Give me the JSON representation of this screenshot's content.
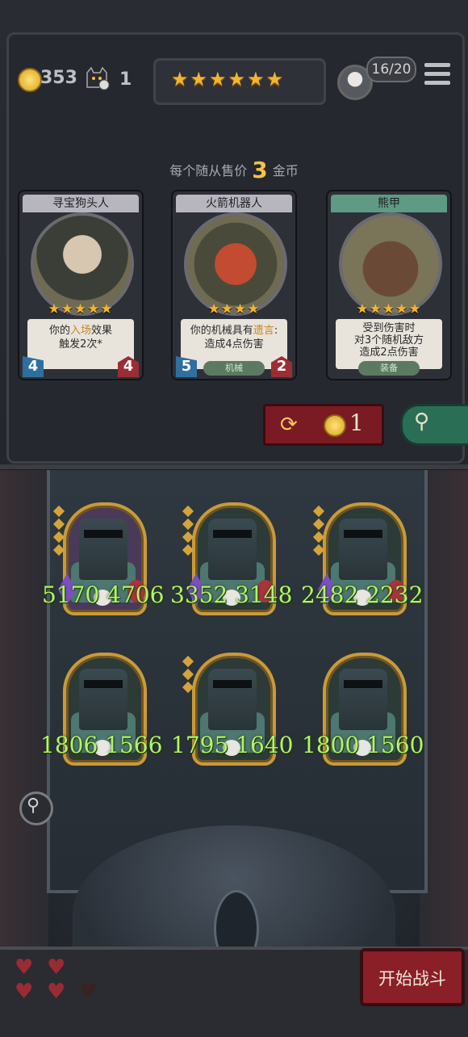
{
  "header": {
    "coins": "353",
    "turn": "1",
    "stars": "★★★★★★",
    "population": "16/20"
  },
  "shop": {
    "price_prefix": "每个随从售价",
    "price_value": "3",
    "price_suffix": "金币",
    "reroll_cost": "1",
    "cards": [
      {
        "name": "寻宝狗头人",
        "rank": "★★★★★",
        "desc_pre": "你的",
        "desc_hl": "入场",
        "desc_post": "效果",
        "desc_line2": "触发2次*",
        "attack": "4",
        "health": "4",
        "tribe": ""
      },
      {
        "name": "火箭机器人",
        "rank": "★★★★",
        "desc_pre": "你的机械具有",
        "desc_hl": "遗言",
        "desc_post": ":",
        "desc_line2": "造成4点伤害",
        "attack": "5",
        "health": "2",
        "tribe": "机械"
      },
      {
        "name": "熊甲",
        "rank": "★★★★★",
        "desc_line1": "受到伤害时",
        "desc_line2": "对3个随机敌方",
        "desc_line3": "造成2点伤害",
        "tribe": "装备"
      }
    ]
  },
  "board": {
    "minions": [
      {
        "attack": "5170",
        "health": "4706"
      },
      {
        "attack": "3352",
        "health": "3148"
      },
      {
        "attack": "2482",
        "health": "2232"
      },
      {
        "attack": "1806",
        "health": "1566"
      },
      {
        "attack": "1795",
        "health": "1640"
      },
      {
        "attack": "1800",
        "health": "1560"
      }
    ],
    "lives_full": 4,
    "lives_total": 5
  },
  "actions": {
    "start_battle": "开始战斗"
  },
  "icons": {
    "coin": "coin-icon",
    "turn": "cat-clock-icon",
    "menu": "hamburger-menu-icon",
    "reroll": "refresh-icon",
    "freeze": "magnifier-icon",
    "zoom": "magnifier-icon",
    "heart": "heart-icon"
  },
  "colors": {
    "accent_gold": "#f2b52f",
    "stat_green": "#b6f26a",
    "button_red": "#8a1f28"
  }
}
